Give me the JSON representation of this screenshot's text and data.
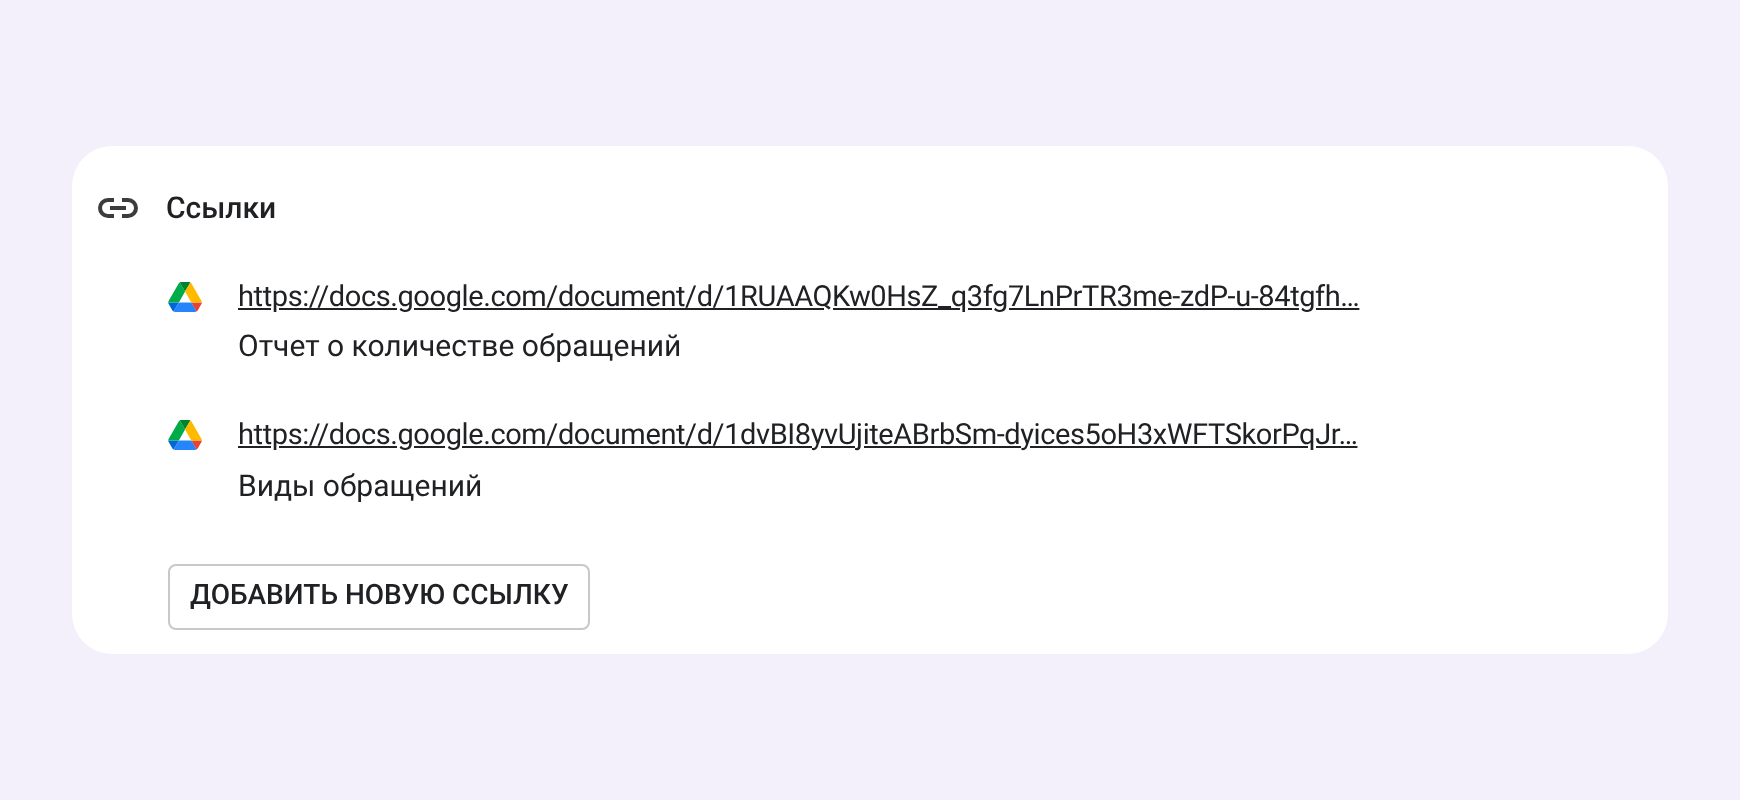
{
  "section": {
    "title": "Ссылки"
  },
  "links": [
    {
      "url": "https://docs.google.com/document/d/1RUAAQKw0HsZ_q3fg7LnPrTR3me-zdP-u-84tgfh…",
      "description": "Отчет о количестве обращений"
    },
    {
      "url": "https://docs.google.com/document/d/1dvBI8yvUjiteABrbSm-dyices5oH3xWFTSkorPqJr…",
      "description": "Виды обращений"
    }
  ],
  "add_button": "ДОБАВИТЬ НОВУЮ ССЫЛКУ"
}
